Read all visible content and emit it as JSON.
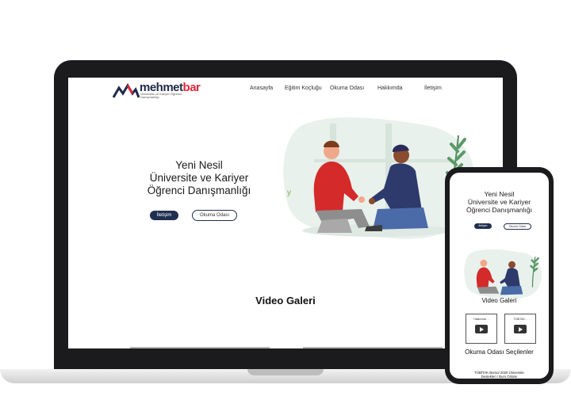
{
  "desktop": {
    "logo": {
      "brand_main": "mehmet",
      "brand_accent": "bar",
      "subtitle": "Üniversite ve Kariyer Öğrenci Danışmanlığı"
    },
    "nav": {
      "items": [
        "Anasayfa",
        "Eğitim Koçluğu",
        "Okuma Odası",
        "Hakkımda",
        "İletişim"
      ]
    },
    "hero": {
      "title_lines": [
        "Yeni Nesil",
        "Üniversite ve Kariyer",
        "Öğrenci Danışmanlığı"
      ],
      "primary_button": "İletişim",
      "secondary_button": "Okuma Odası"
    },
    "video_section": {
      "title": "Video Galeri"
    }
  },
  "mobile": {
    "hero": {
      "title_lines": [
        "Yeni Nesil",
        "Üniversite ve Kariyer",
        "Öğrenci Danışmanlığı"
      ],
      "primary_button": "İletişim",
      "secondary_button": "Okuma Odası"
    },
    "video_section": {
      "title": "Video Galeri",
      "cards": [
        {
          "label": "Hakkımda ..."
        },
        {
          "label": "TÜBİTAK..."
        }
      ]
    },
    "reading_section": {
      "title": "Okuma Odası Seçilenler"
    },
    "footer": {
      "text_lines": [
        "TÜBİTAK Bursu/ 2020 Üniversite",
        "Destekleri / Burs Ortamı"
      ]
    }
  },
  "colors": {
    "navy": "#1f2f4f",
    "brand_red": "#e0283a",
    "device_frame": "#1b1b1d",
    "illustration_bg": "#e9f1ec",
    "red_shirt": "#d42a2a",
    "blue_shirt": "#2e3a6b"
  },
  "icons": [
    "play-icon",
    "leaf-icon",
    "logo-mark-icon"
  ]
}
